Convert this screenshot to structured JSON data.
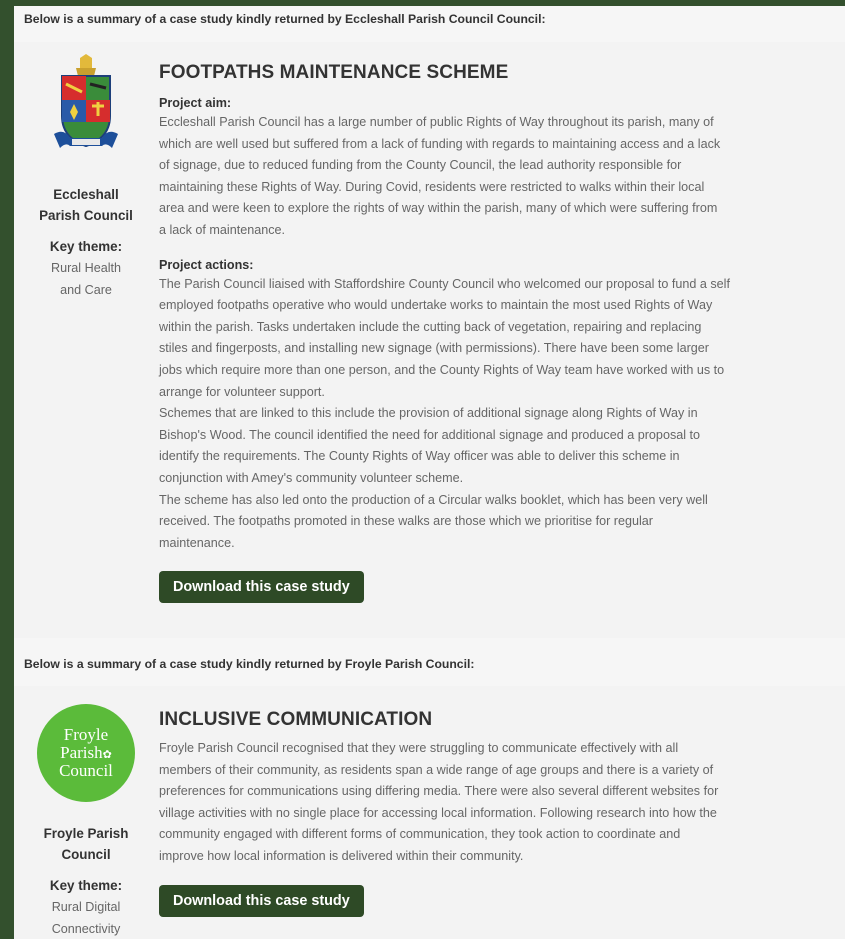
{
  "studies": [
    {
      "intro": "Below is a summary of a case study kindly returned by Eccleshall Parish Council Council:",
      "org_name_line1": "Eccleshall",
      "org_name_line2": "Parish Council",
      "key_theme_label": "Key theme:",
      "key_theme_line1": "Rural Health",
      "key_theme_line2": "and Care",
      "title": "FOOTPATHS MAINTENANCE SCHEME",
      "aim_heading": "Project aim:",
      "aim_lines": [
        "Eccleshall Parish Council has a large number of public Rights of Way throughout its parish, many of",
        "which are well used but suffered from a lack of funding with regards to maintaining access and a lack",
        "of signage, due to reduced funding from the County Council, the lead authority responsible for",
        "maintaining these Rights of Way. During Covid, residents were restricted to walks within their local",
        "area and were keen to explore the rights of way within the parish, many of which were suffering from",
        "a lack of maintenance."
      ],
      "actions_heading": "Project actions:",
      "action_lines": [
        "The Parish Council liaised with Staffordshire County Council who welcomed our proposal to fund a self",
        "employed footpaths operative who would undertake works to maintain the most used Rights of Way",
        "within the parish. Tasks undertaken include the cutting back of vegetation, repairing and replacing",
        "stiles and fingerposts, and installing new signage (with permissions). There have been some larger",
        "jobs which require more than one person, and the County Rights of Way team have worked with us to",
        "arrange for volunteer support.",
        "Schemes that are linked to this include the provision of additional signage along Rights of Way in",
        "Bishop's Wood. The council identified the need for additional signage and produced a proposal to",
        "identify the requirements. The County Rights of Way officer was able to deliver this scheme in",
        "conjunction with Amey's community volunteer scheme.",
        "The scheme has also led onto the production of a Circular walks booklet, which has been very well",
        "received. The footpaths promoted in these walks are those which we prioritise for regular",
        "maintenance."
      ],
      "download_label": "Download this case study"
    },
    {
      "intro": "Below is a summary of a case study kindly returned by Froyle Parish Council:",
      "logo_line1": "Froyle",
      "logo_line2": "Parish",
      "logo_line3": "Council",
      "org_name_line1": "Froyle Parish",
      "org_name_line2": "Council",
      "key_theme_label": "Key theme:",
      "key_theme_line1": "Rural Digital",
      "key_theme_line2": "Connectivity",
      "title": "INCLUSIVE COMMUNICATION",
      "desc_lines": [
        "Froyle Parish Council recognised that they were struggling to communicate effectively with all",
        "members of their community, as residents span a wide range of age groups and there is a variety of",
        "preferences for communications using differing media. There were also several different websites for",
        "village activities with no single place for accessing local information.  Following research into how the",
        "community engaged with different forms of communication, they took action to coordinate and",
        "improve how local information is delivered within their community."
      ],
      "download_label": "Download this case study"
    }
  ]
}
